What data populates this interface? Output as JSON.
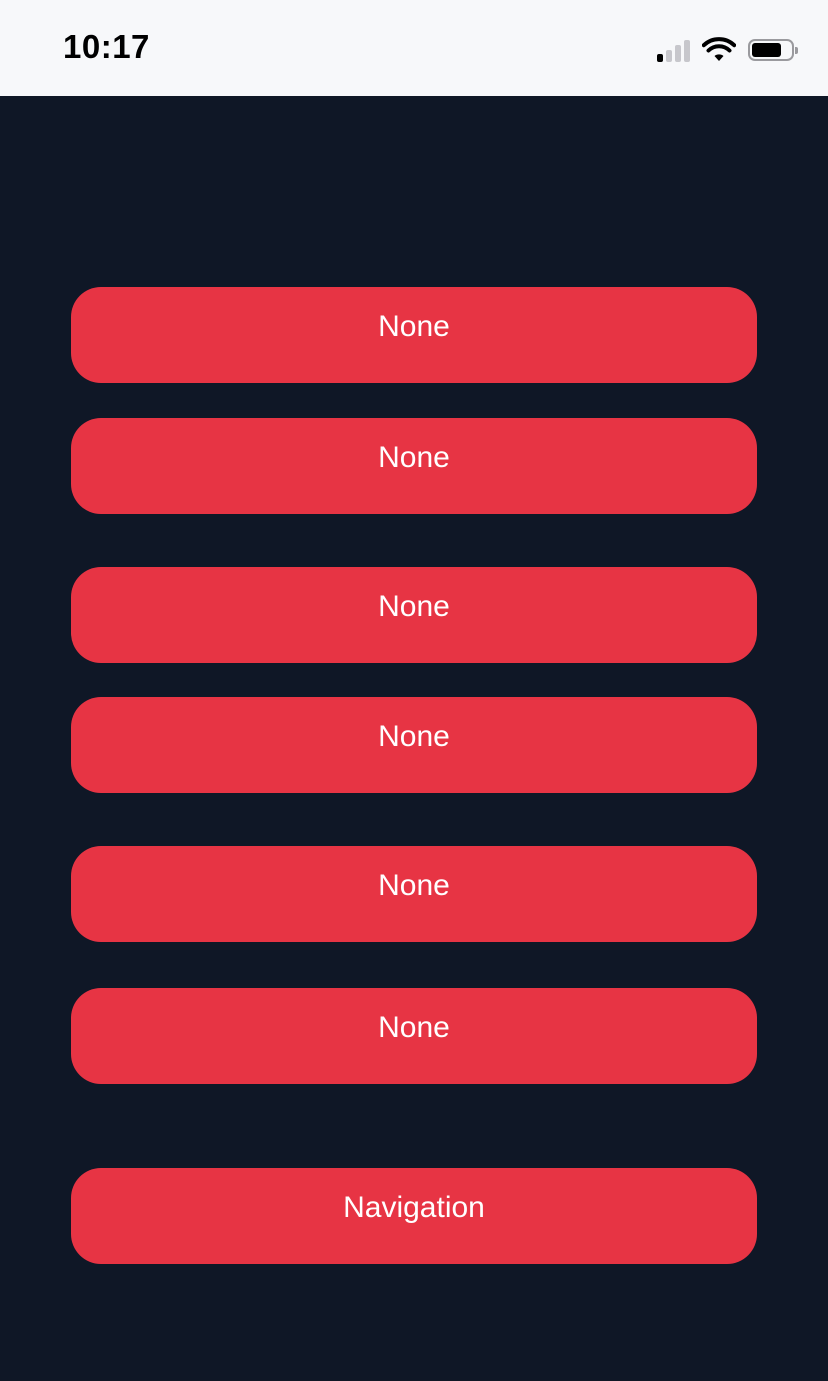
{
  "status_bar": {
    "time": "10:17",
    "signal_bars_on": 1,
    "signal_bars_total": 4,
    "wifi_icon": "wifi-icon",
    "battery_level": 0.7
  },
  "theme": {
    "background": "#0f1726",
    "button_color": "#e73444",
    "button_text_color": "#ffffff"
  },
  "buttons": [
    {
      "label": "None"
    },
    {
      "label": "None"
    },
    {
      "label": "None"
    },
    {
      "label": "None"
    },
    {
      "label": "None"
    },
    {
      "label": "None"
    },
    {
      "label": "Navigation"
    }
  ]
}
